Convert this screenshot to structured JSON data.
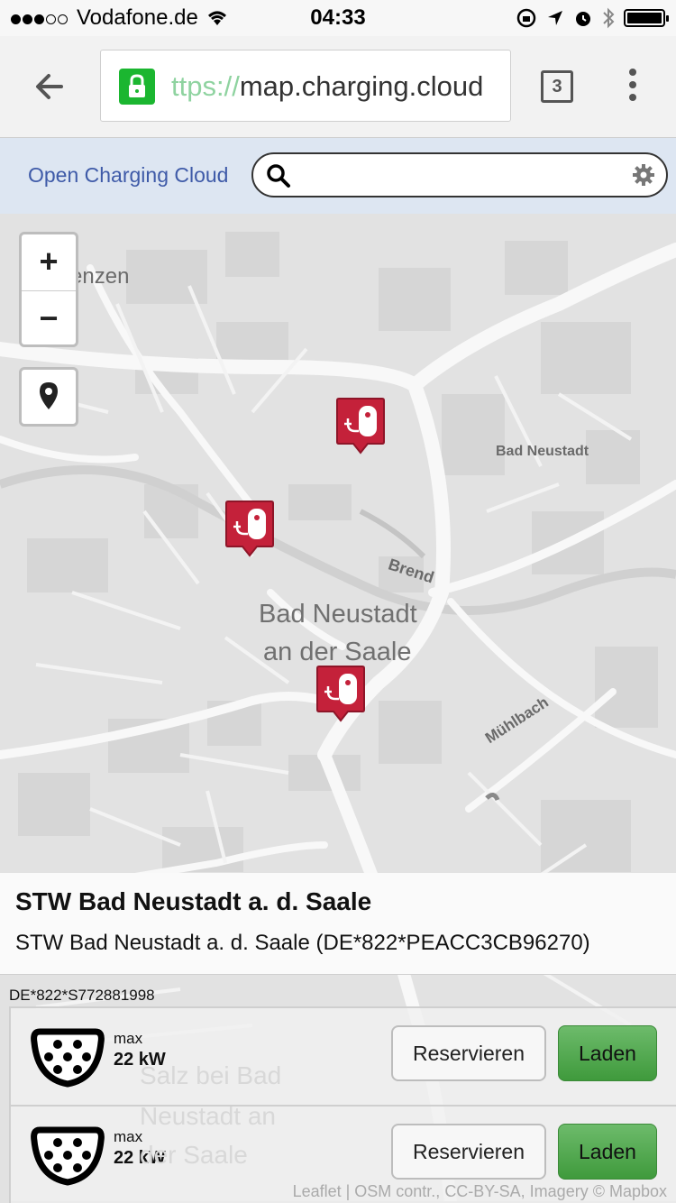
{
  "status_bar": {
    "carrier": "Vodafone.de",
    "time": "04:33"
  },
  "browser": {
    "url_faded": "ttps://",
    "url_main": "map.charging.cloud",
    "tab_count": "3"
  },
  "header": {
    "brand": "Open Charging Cloud",
    "search_placeholder": ""
  },
  "map": {
    "labels": {
      "lorenzen": "dlorenzen",
      "lorenzen_prefix": "B",
      "bad_neustadt_small": "Bad Neustadt",
      "city_line1": "Bad Neustadt",
      "city_line2": "an der Saale",
      "street_brend": "Brend",
      "street_muehlbach": "Mühlbach",
      "ghost_line1": "Salz bei Bad",
      "ghost_line2": "Neustadt an",
      "ghost_line3": "der Saale"
    },
    "zoom_in": "+",
    "zoom_out": "−",
    "attribution": "Leaflet | OSM contr., CC-BY-SA, Imagery © Mapbox",
    "marker_color": "#c4213a"
  },
  "station": {
    "title": "STW Bad Neustadt a. d. Saale",
    "subtitle": "STW Bad Neustadt a. d. Saale (DE*822*PEACC3CB96270)",
    "evse_id": "DE*822*S772881998",
    "connectors": [
      {
        "max_label": "max",
        "power": "22 kW",
        "reserve_label": "Reservieren",
        "charge_label": "Laden"
      },
      {
        "max_label": "max",
        "power": "22 kW",
        "reserve_label": "Reservieren",
        "charge_label": "Laden"
      }
    ]
  }
}
